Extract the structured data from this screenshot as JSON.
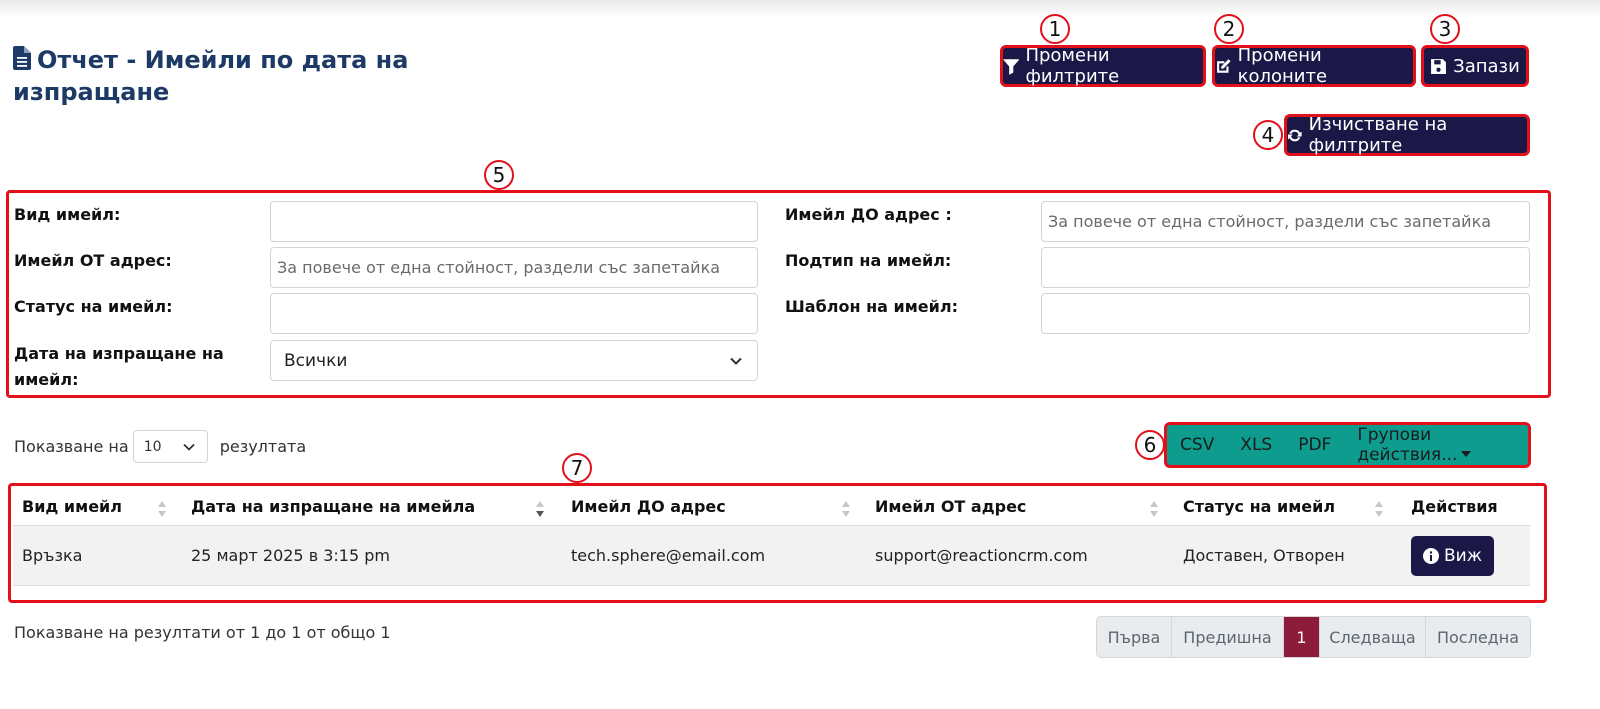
{
  "title": "Отчет - Имейли по дата на изпращане",
  "toolbar": {
    "change_filters": "Промени филтрите",
    "change_columns": "Промени колоните",
    "save": "Запази",
    "clear_filters": "Изчистване на филтрите"
  },
  "annotations": [
    "1",
    "2",
    "3",
    "4",
    "5",
    "6",
    "7"
  ],
  "filters": {
    "email_type": {
      "label": "Вид имейл:",
      "value": ""
    },
    "email_to": {
      "label": "Имейл ДО адрес :",
      "placeholder": "За повече от една стойност, раздели със запетайка"
    },
    "email_from": {
      "label": "Имейл ОТ адрес:",
      "placeholder": "За повече от една стойност, раздели със запетайка"
    },
    "email_subtype": {
      "label": "Подтип на имейл:",
      "value": ""
    },
    "email_status": {
      "label": "Статус на имейл:",
      "value": ""
    },
    "email_template": {
      "label": "Шаблон на имейл:",
      "value": ""
    },
    "send_date": {
      "label": "Дата на изпращане на имейл:",
      "selected": "Всички"
    }
  },
  "list_controls": {
    "showing_prefix": "Показване на",
    "page_size": "10",
    "showing_suffix": "резултата"
  },
  "export": {
    "csv": "CSV",
    "xls": "XLS",
    "pdf": "PDF",
    "bulk_actions": "Групови действия..."
  },
  "table": {
    "columns": [
      "Вид имейл",
      "Дата на изпращане на имейла",
      "Имейл ДО адрес",
      "Имейл ОТ адрес",
      "Статус на имейл",
      "Действия"
    ],
    "rows": [
      {
        "type": "Връзка",
        "date": "25 март 2025 в 3:15 pm",
        "to": "tech.sphere@email.com",
        "from": "support@reactioncrm.com",
        "status": "Доставен, Отворен",
        "action": "Виж"
      }
    ]
  },
  "summary": "Показване на резултати от 1 до 1 от общо 1",
  "pagination": {
    "first": "Първа",
    "prev": "Предишна",
    "current": "1",
    "next": "Следваща",
    "last": "Последна"
  },
  "colors": {
    "primary": "#1b1848",
    "highlight": "#e3101a",
    "export_bg": "#0d9c8e",
    "active_page": "#8c1c3a",
    "title": "#1d3a66"
  }
}
